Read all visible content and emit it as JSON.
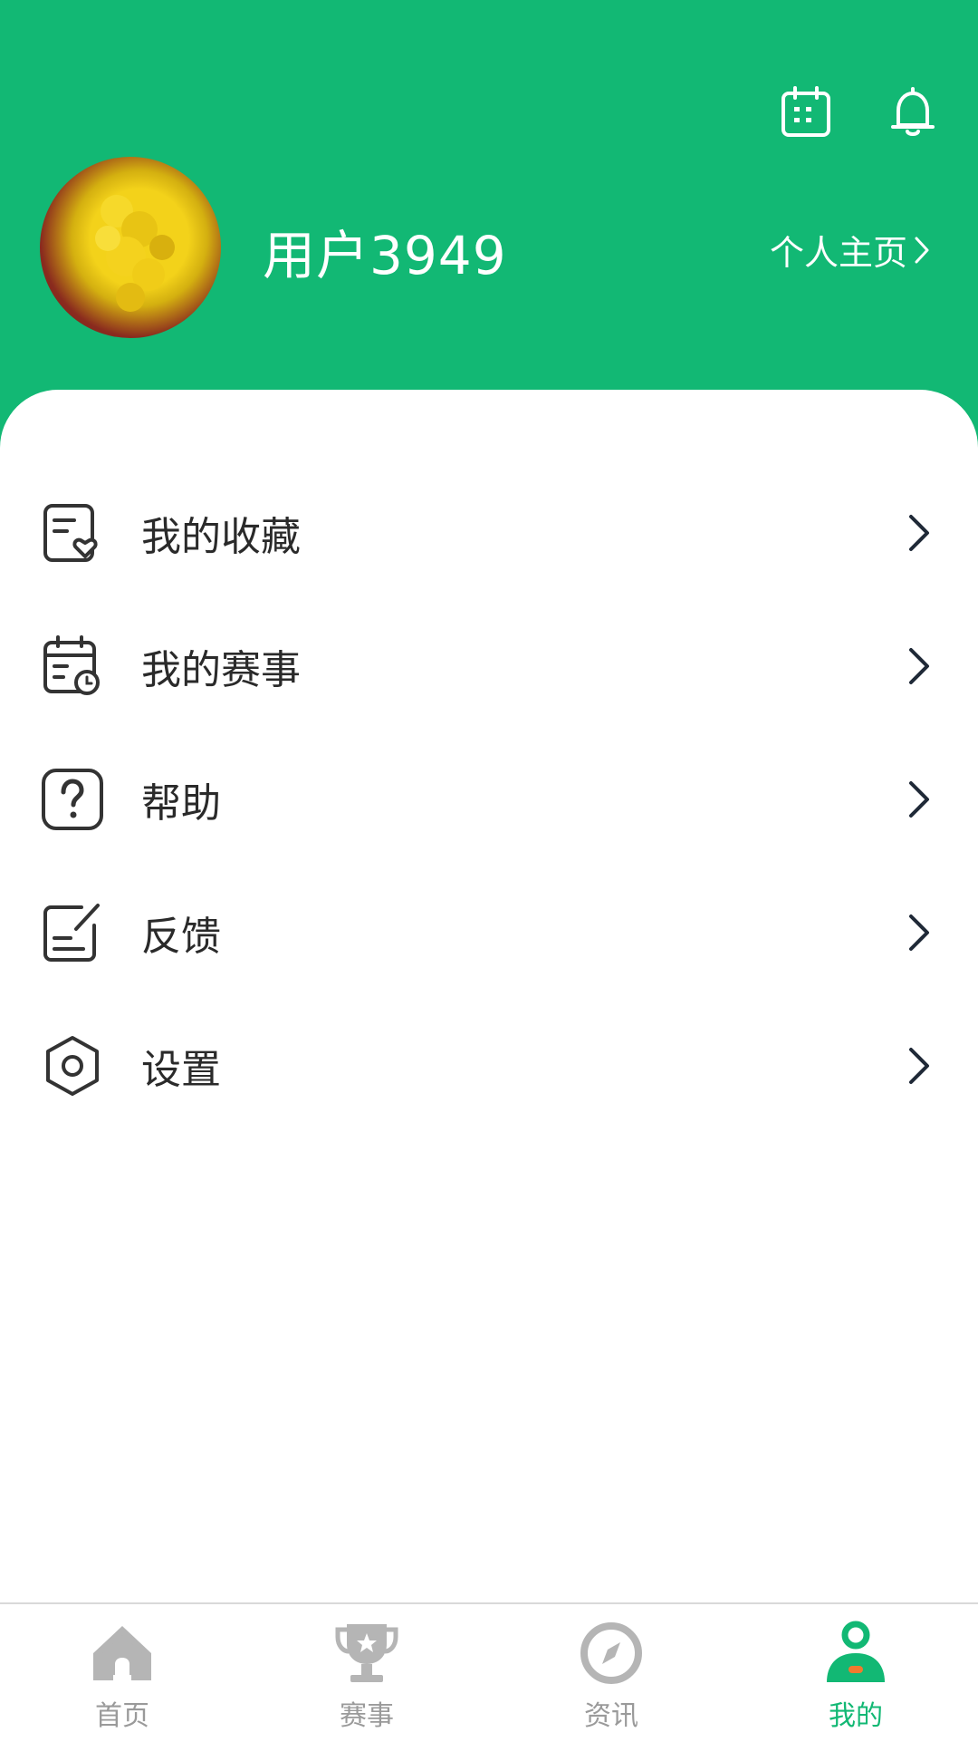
{
  "header": {
    "username": "用户3949",
    "profile_link": "个人主页",
    "icons": [
      "calendar-icon",
      "bell-icon"
    ],
    "accent": "#12b874"
  },
  "menu": {
    "items": [
      {
        "label": "我的收藏",
        "icon": "favorites-icon"
      },
      {
        "label": "我的赛事",
        "icon": "my-events-icon"
      },
      {
        "label": "帮助",
        "icon": "help-icon"
      },
      {
        "label": "反馈",
        "icon": "feedback-icon"
      },
      {
        "label": "设置",
        "icon": "settings-icon"
      }
    ]
  },
  "tabbar": {
    "tabs": [
      {
        "label": "首页",
        "icon": "home-icon",
        "active": false
      },
      {
        "label": "赛事",
        "icon": "trophy-icon",
        "active": false
      },
      {
        "label": "资讯",
        "icon": "compass-icon",
        "active": false
      },
      {
        "label": "我的",
        "icon": "profile-icon",
        "active": true
      }
    ],
    "active_color": "#12b874",
    "inactive_color": "#9a9a9a"
  }
}
